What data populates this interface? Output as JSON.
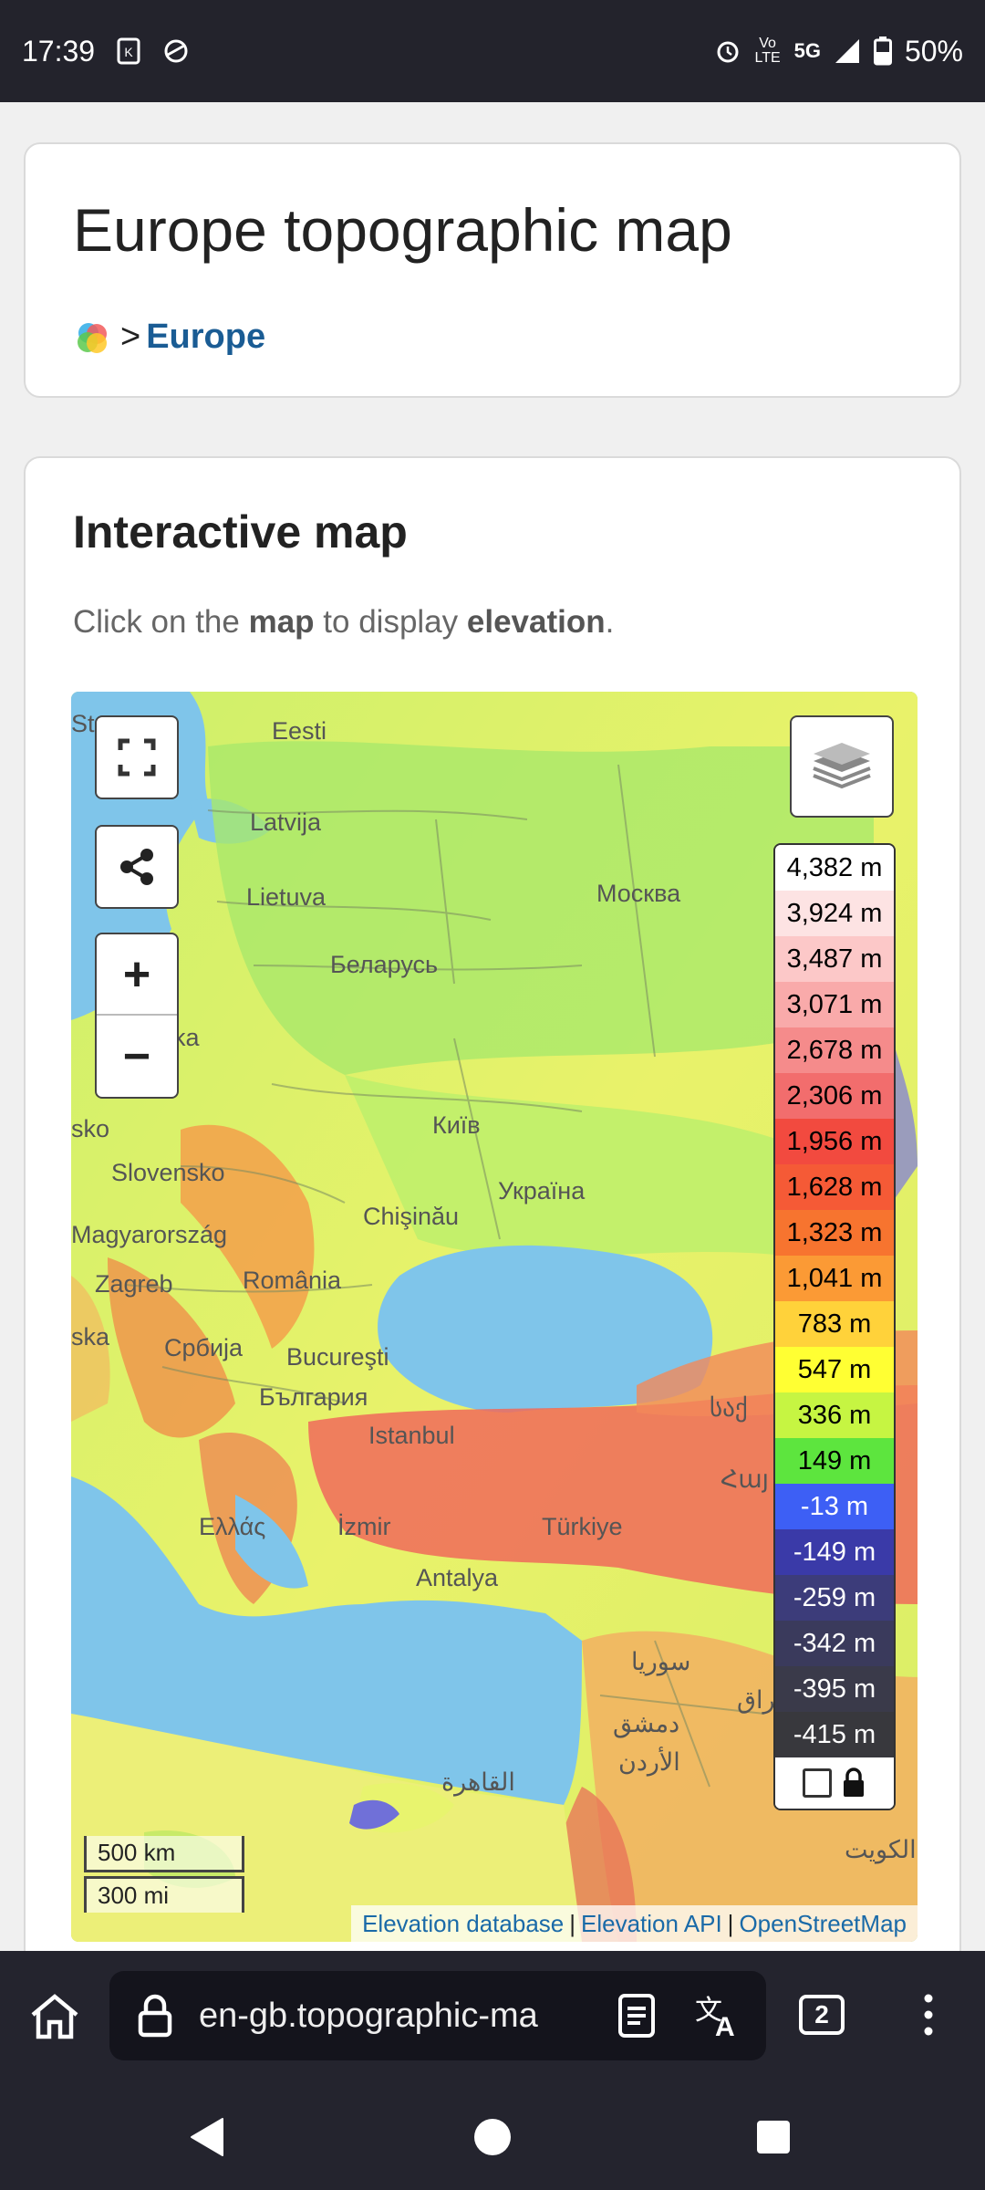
{
  "status": {
    "time": "17:39",
    "net": "5G",
    "battery": "50%",
    "volte": "Vo LTE"
  },
  "header": {
    "title": "Europe topographic map",
    "breadcrumb_sep": ">",
    "breadcrumb_link": "Europe"
  },
  "section": {
    "title": "Interactive map",
    "desc_pre": "Click on the ",
    "desc_b1": "map",
    "desc_mid": " to display ",
    "desc_b2": "elevation",
    "desc_post": "."
  },
  "map": {
    "labels": [
      "Eesti",
      "Latvija",
      "Lietuva",
      "Москва",
      "Беларусь",
      "Київ",
      "Slovensko",
      "Україна",
      "Chişinău",
      "Magyarország",
      "Zagreb",
      "România",
      "Србија",
      "Bucureşti",
      "България",
      "Istanbul",
      "Ελλάς",
      "İzmir",
      "Türkiye",
      "Antalya",
      "سوريا",
      "دمشق",
      "الأردن",
      "القاهرة",
      "العراق",
      "الكويت",
      "საქ",
      "Հայ",
      "ka",
      "sko",
      "ska",
      "St"
    ],
    "legend": [
      {
        "label": "4,382 m",
        "color": "#ffffff"
      },
      {
        "label": "3,924 m",
        "color": "#fde3e3"
      },
      {
        "label": "3,487 m",
        "color": "#fcc8c8"
      },
      {
        "label": "3,071 m",
        "color": "#f9aaaa"
      },
      {
        "label": "2,678 m",
        "color": "#f58b8b"
      },
      {
        "label": "2,306 m",
        "color": "#f26d6d"
      },
      {
        "label": "1,956 m",
        "color": "#f24a3f"
      },
      {
        "label": "1,628 m",
        "color": "#f55a36"
      },
      {
        "label": "1,323 m",
        "color": "#f7742f"
      },
      {
        "label": "1,041 m",
        "color": "#fb9a35"
      },
      {
        "label": "783 m",
        "color": "#ffd23a"
      },
      {
        "label": "547 m",
        "color": "#ffff33"
      },
      {
        "label": "336 m",
        "color": "#c6f542"
      },
      {
        "label": "149 m",
        "color": "#5de53e"
      },
      {
        "label": "-13 m",
        "color": "#3d5ff5"
      },
      {
        "label": "-149 m",
        "color": "#3a3aa8"
      },
      {
        "label": "-259 m",
        "color": "#3c3c7a"
      },
      {
        "label": "-342 m",
        "color": "#3a3a5c"
      },
      {
        "label": "-395 m",
        "color": "#3a3a4a"
      },
      {
        "label": "-415 m",
        "color": "#38383d"
      }
    ],
    "scale_km": "500 km",
    "scale_mi": "300 mi",
    "attrib": [
      "Elevation database",
      "Elevation API",
      "OpenStreetMap"
    ]
  },
  "browser": {
    "url": "en-gb.topographic-ma",
    "tabs": "2"
  }
}
